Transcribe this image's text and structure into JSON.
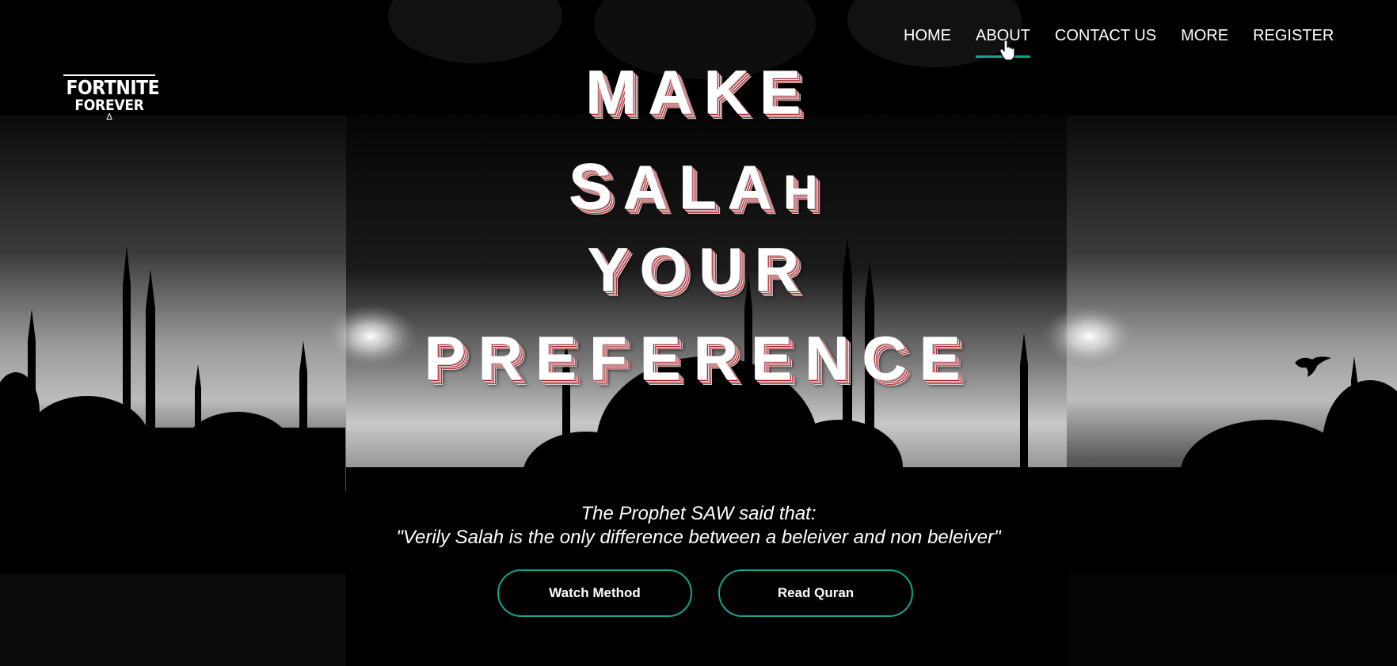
{
  "logo": {
    "line1": "FORTNITE",
    "line2": "FOREVER"
  },
  "nav": {
    "items": [
      {
        "label": "HOME"
      },
      {
        "label": "ABOUT",
        "active": true
      },
      {
        "label": "CONTACT US"
      },
      {
        "label": "MORE"
      },
      {
        "label": "REGISTER"
      }
    ],
    "active_underline_color": "#12a38f"
  },
  "hero": {
    "line1": "MAKE",
    "line2": {
      "s": "S",
      "rest": "ALA",
      "h": "H"
    },
    "line3": "YOUR",
    "line4": "PREFERENCE",
    "shadow_color": "#b02a30"
  },
  "quote": {
    "intro": "The Prophet SAW said that:",
    "text": "\"Verily Salah is the only difference between a beleiver and non beleiver\""
  },
  "buttons": {
    "watch": "Watch Method",
    "read": "Read Quran",
    "border_color": "#12a38f"
  }
}
